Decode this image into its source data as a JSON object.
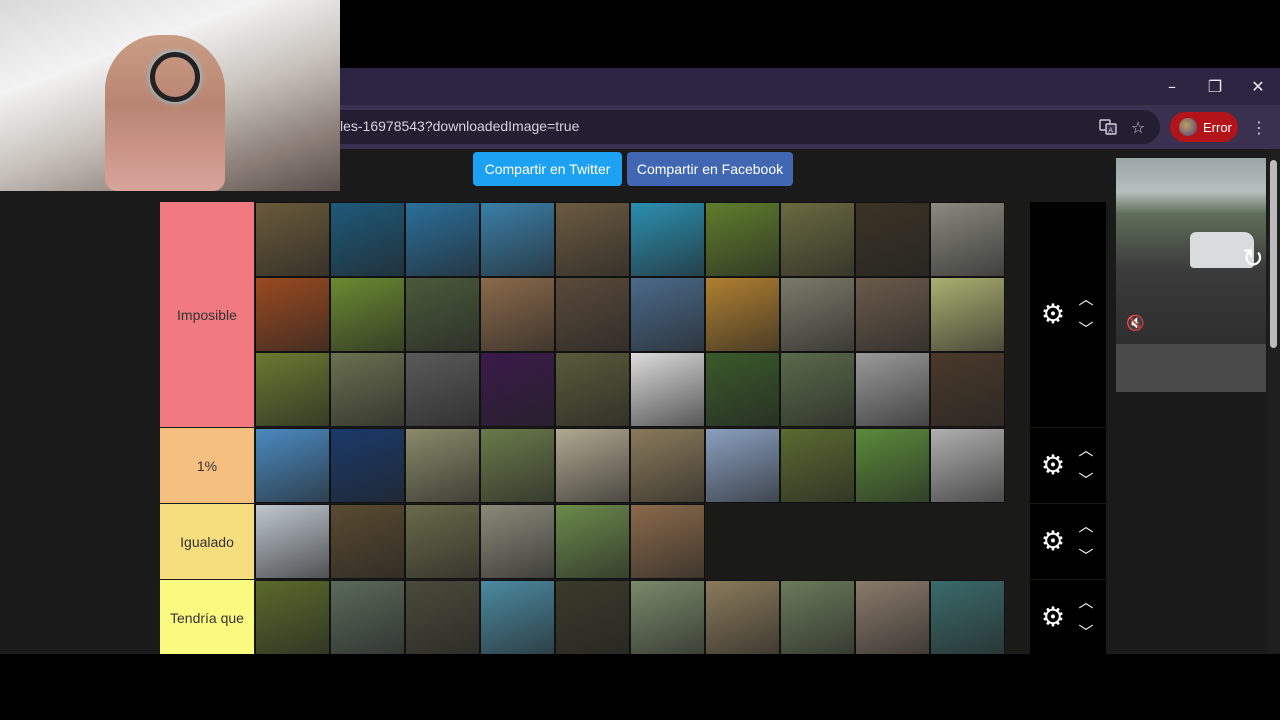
{
  "browser": {
    "url": "les-16978543?downloadedImage=true",
    "error_label": "Error",
    "window_controls": {
      "minimize": "–",
      "restore": "❐",
      "close": "✕"
    },
    "toolbar_icons": [
      "translate-icon",
      "star-icon",
      "menu-icon"
    ]
  },
  "share": {
    "twitter_label": "Compartir en Twitter",
    "facebook_label": "Compartir en Facebook"
  },
  "tiers": [
    {
      "label": "Imposible",
      "color": "#f07a7f",
      "tiles": 30
    },
    {
      "label": "1%",
      "color": "#f5bf7f",
      "tiles": 10
    },
    {
      "label": "Igualado",
      "color": "#f6dd7d",
      "tiles": 6
    },
    {
      "label": "Tendría que",
      "color": "#fbfa80",
      "tiles": 10
    }
  ],
  "controls": {
    "gear": "⚙",
    "up": "︿",
    "down": "﹀"
  },
  "video": {
    "muted_icon": "🔇"
  }
}
